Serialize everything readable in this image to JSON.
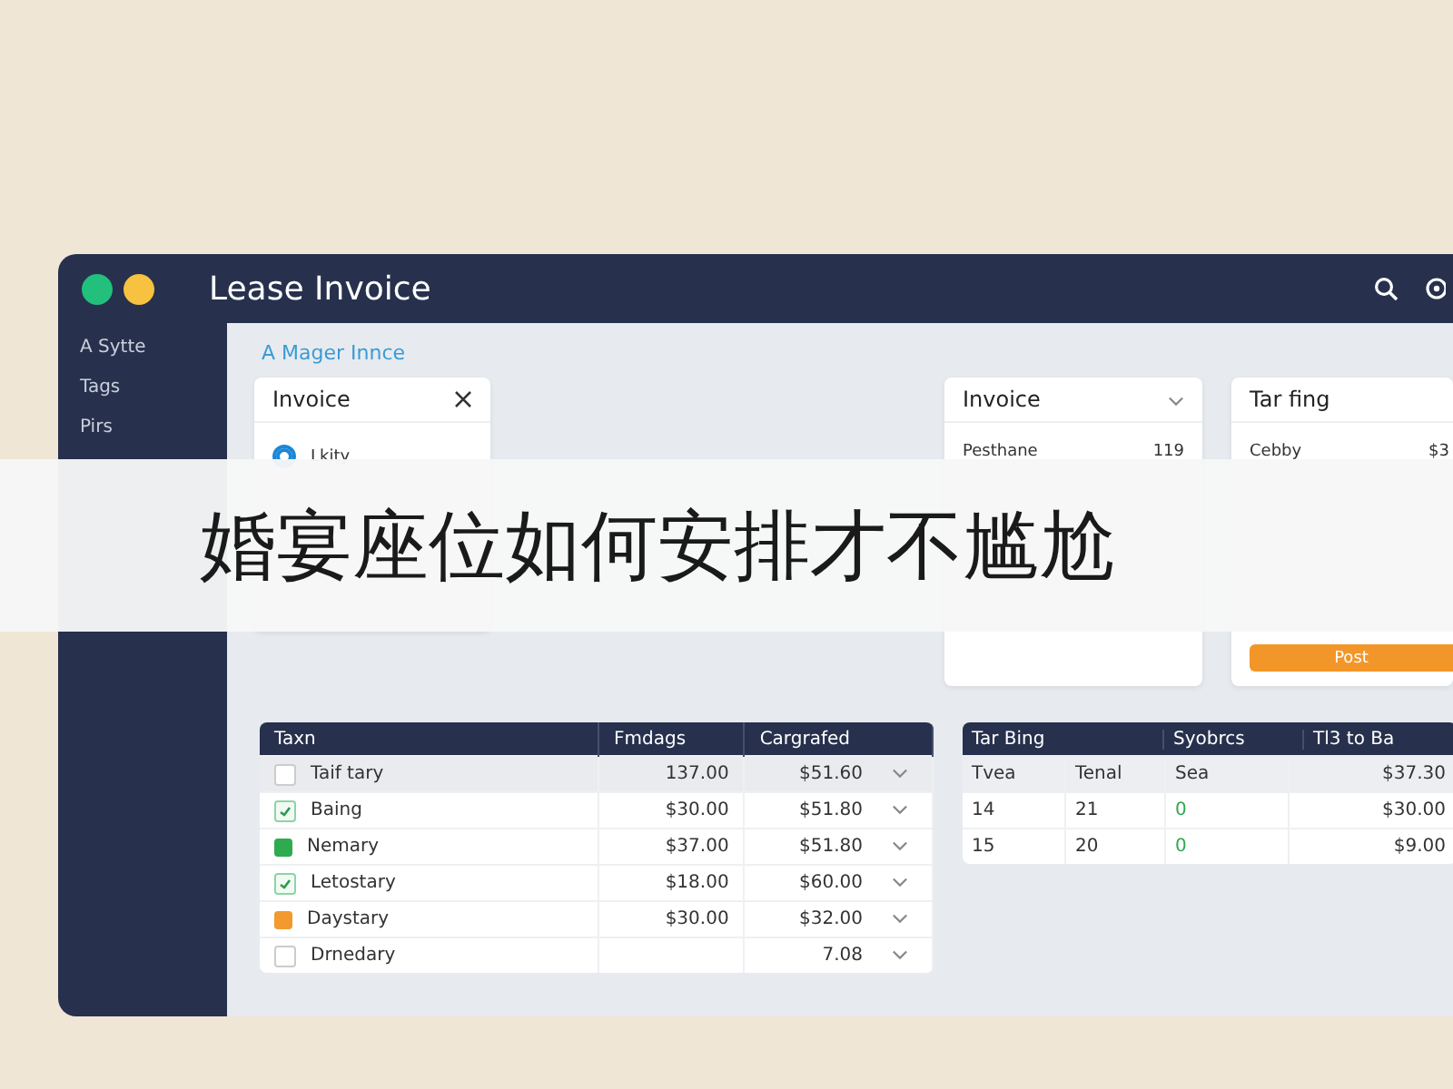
{
  "window": {
    "title": "Lease Invoice"
  },
  "sidebar": {
    "items": [
      {
        "label": "A Sytte",
        "selected": false
      },
      {
        "label": "Tags",
        "selected": false
      },
      {
        "label": "Pirs",
        "selected": false
      }
    ]
  },
  "breadcrumb": "A Mager Innce",
  "invoice_card": {
    "title": "Invoice",
    "options": [
      {
        "label": "Lkity",
        "selected": true
      }
    ]
  },
  "summary_card": {
    "title": "Invoice",
    "rows": [
      {
        "label": "Pesthane",
        "value": "119"
      }
    ]
  },
  "billing_card": {
    "title": "Tar fing",
    "rows": [
      {
        "label": "Cebby",
        "value": "$3"
      }
    ],
    "button": "Post"
  },
  "items_table": {
    "columns": [
      "Taxn",
      "Fmdags",
      "Cargrafed"
    ],
    "rows": [
      {
        "kind": "empty",
        "name": "Taif tary",
        "amount": "137.00",
        "total": "$51.60",
        "selected": true
      },
      {
        "kind": "check",
        "name": "Baing",
        "amount": "$30.00",
        "total": "$51.80",
        "selected": false
      },
      {
        "kind": "green",
        "name": "Nemary",
        "amount": "$37.00",
        "total": "$51.80",
        "selected": false
      },
      {
        "kind": "check",
        "name": "Letostary",
        "amount": "$18.00",
        "total": "$60.00",
        "selected": false
      },
      {
        "kind": "orange",
        "name": "Daystary",
        "amount": "$30.00",
        "total": "$32.00",
        "selected": false
      },
      {
        "kind": "empty",
        "name": "Drnedary",
        "amount": "",
        "total": "7.08",
        "selected": false
      }
    ]
  },
  "rates_table": {
    "header_labels": [
      "Tar Bing",
      "Syobrcs",
      "Tl3 to Ba"
    ],
    "subheader": [
      "Tvea",
      "Tenal",
      "Sea",
      "$37.30"
    ],
    "rows": [
      [
        "14",
        "21",
        "0",
        "$30.00"
      ],
      [
        "15",
        "20",
        "0",
        "$9.00"
      ]
    ]
  },
  "caption": "婚宴座位如何安排才不尴尬"
}
